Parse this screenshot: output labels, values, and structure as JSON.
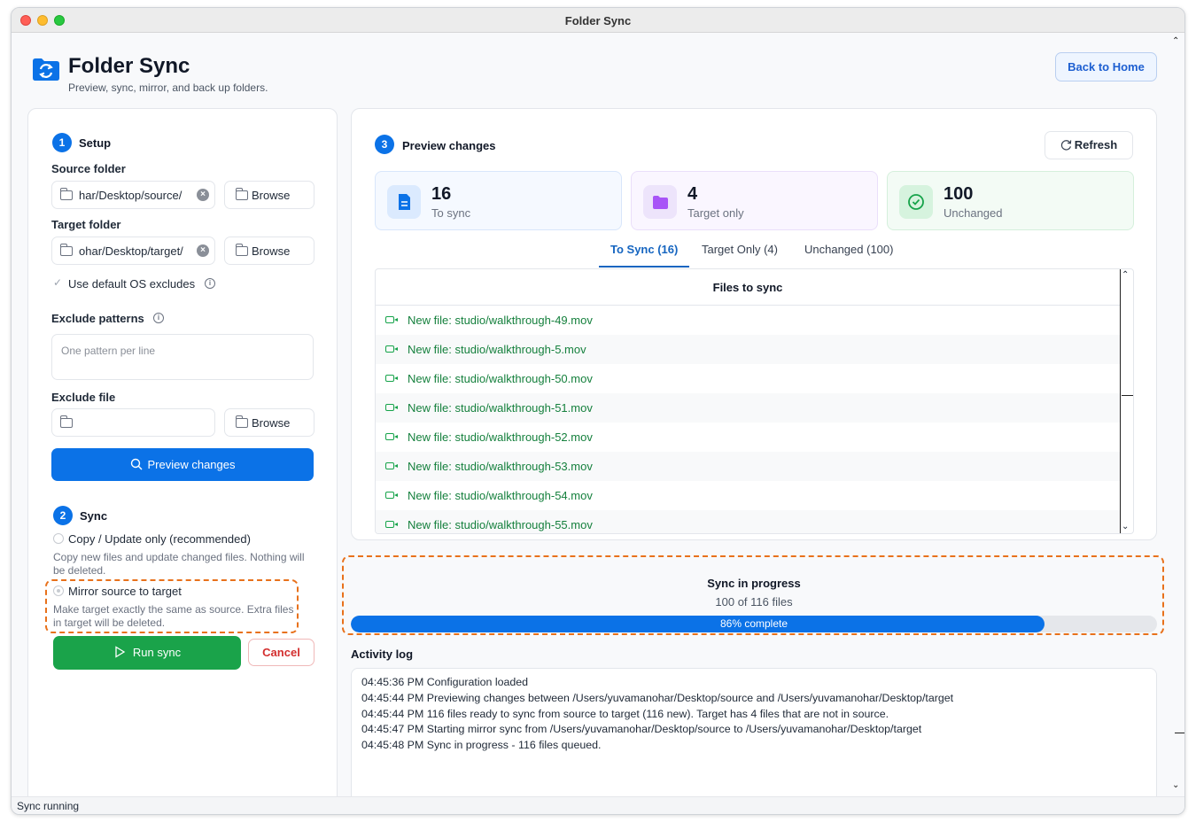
{
  "window": {
    "title": "Folder Sync"
  },
  "header": {
    "title": "Folder Sync",
    "subtitle": "Preview, sync, mirror, and back up folders.",
    "back_button": "Back to Home"
  },
  "setup": {
    "step_number": "1",
    "heading": "Setup",
    "source_label": "Source folder",
    "source_value": "har/Desktop/source/",
    "target_label": "Target folder",
    "target_value": "ohar/Desktop/target/",
    "browse_label": "Browse",
    "default_excludes_label": "Use default OS excludes",
    "exclude_patterns_label": "Exclude patterns",
    "exclude_patterns_placeholder": "One pattern per line",
    "exclude_file_label": "Exclude file",
    "exclude_file_value": "",
    "preview_button": "Preview changes"
  },
  "sync": {
    "step_number": "2",
    "heading": "Sync",
    "option1_label": "Copy / Update only (recommended)",
    "option1_desc": "Copy new files and update changed files. Nothing will be deleted.",
    "option2_label": "Mirror source to target",
    "option2_desc": "Make target exactly the same as source. Extra files in target will be deleted.",
    "run_button": "Run sync",
    "cancel_button": "Cancel"
  },
  "preview": {
    "step_number": "3",
    "heading": "Preview changes",
    "refresh_button": "Refresh",
    "stats": [
      {
        "number": "16",
        "label": "To sync"
      },
      {
        "number": "4",
        "label": "Target only"
      },
      {
        "number": "100",
        "label": "Unchanged"
      }
    ],
    "tabs": [
      "To Sync (16)",
      "Target Only (4)",
      "Unchanged (100)"
    ],
    "list_header": "Files to sync",
    "files": [
      "New file: studio/walkthrough-49.mov",
      "New file: studio/walkthrough-5.mov",
      "New file: studio/walkthrough-50.mov",
      "New file: studio/walkthrough-51.mov",
      "New file: studio/walkthrough-52.mov",
      "New file: studio/walkthrough-53.mov",
      "New file: studio/walkthrough-54.mov",
      "New file: studio/walkthrough-55.mov"
    ]
  },
  "progress": {
    "title": "Sync in progress",
    "count_text": "100 of 116 files",
    "percent": 86,
    "label": "86% complete"
  },
  "activity": {
    "label": "Activity log",
    "lines": [
      "04:45:36 PM  Configuration loaded",
      "04:45:44 PM  Previewing changes between /Users/yuvamanohar/Desktop/source and /Users/yuvamanohar/Desktop/target",
      "04:45:44 PM  116 files ready to sync from source to target (116 new). Target has 4 files that are not in source.",
      "04:45:47 PM  Starting mirror sync from /Users/yuvamanohar/Desktop/source to /Users/yuvamanohar/Desktop/target",
      "04:45:48 PM  Sync in progress - 116 files queued."
    ]
  },
  "statusbar": {
    "text": "Sync running"
  },
  "colors": {
    "accent": "#0b72e7",
    "success": "#1aa34a",
    "danger": "#d32f2f",
    "highlight": "#e8711b"
  }
}
